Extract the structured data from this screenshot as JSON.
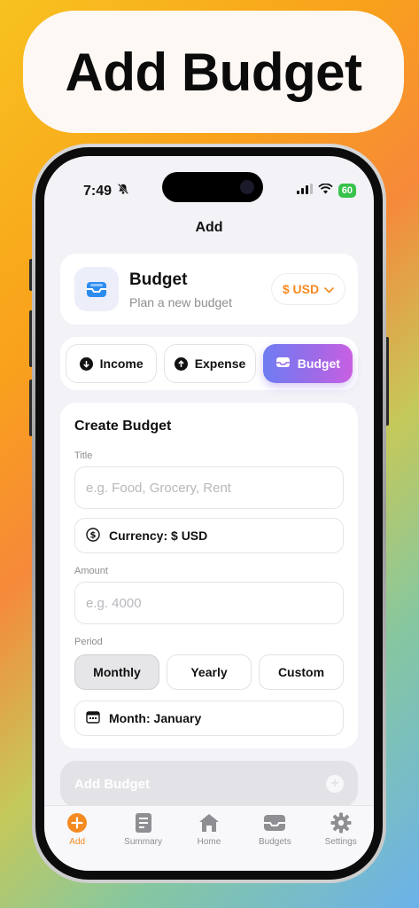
{
  "banner": {
    "title": "Add Budget"
  },
  "status": {
    "time": "7:49",
    "battery": "60"
  },
  "nav": {
    "title": "Add"
  },
  "header": {
    "title": "Budget",
    "subtitle": "Plan a new budget",
    "currency": "$ USD"
  },
  "segments": [
    {
      "label": "Income",
      "icon": "arrow-down-circle-icon",
      "active": false
    },
    {
      "label": "Expense",
      "icon": "arrow-up-circle-icon",
      "active": false
    },
    {
      "label": "Budget",
      "icon": "tray-icon",
      "active": true
    }
  ],
  "form": {
    "heading": "Create Budget",
    "title_label": "Title",
    "title_placeholder": "e.g. Food, Grocery, Rent",
    "currency_value": "Currency: $ USD",
    "amount_label": "Amount",
    "amount_placeholder": "e.g. 4000",
    "period_label": "Period",
    "periods": [
      "Monthly",
      "Yearly",
      "Custom"
    ],
    "selected_period": "Monthly",
    "month_value": "Month: January"
  },
  "submit": {
    "label": "Add Budget"
  },
  "tabs": [
    {
      "label": "Add",
      "icon": "plus-circle-icon",
      "active": true
    },
    {
      "label": "Summary",
      "icon": "document-icon",
      "active": false
    },
    {
      "label": "Home",
      "icon": "house-icon",
      "active": false
    },
    {
      "label": "Budgets",
      "icon": "tray-icon",
      "active": false
    },
    {
      "label": "Settings",
      "icon": "gear-icon",
      "active": false
    }
  ],
  "colors": {
    "accent": "#f48a21",
    "gradient_start": "#6f7df2",
    "gradient_end": "#c95fe2"
  }
}
